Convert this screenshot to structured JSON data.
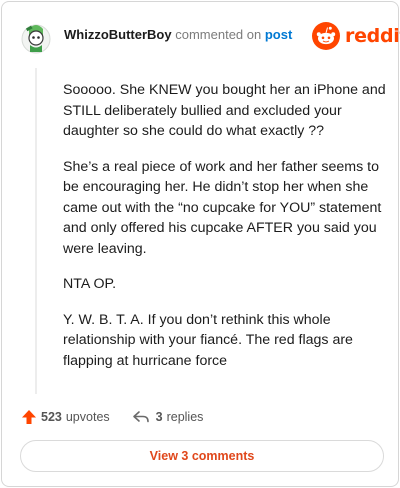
{
  "header": {
    "username": "WhizzoButterBoy",
    "commented_on": "commented on",
    "post_link": "post",
    "brand": "reddit",
    "brand_color": "#ff4500",
    "avatar_icon": "snoo-avatar-icon"
  },
  "comment": {
    "paragraphs": [
      "Sooooo. She KNEW you bought her an iPhone and STILL deliberately bullied and excluded your daughter so she could do what exactly ??",
      "She’s a real piece of work and her father seems to be encouraging her. He didn’t stop her when she came out with the “no cupcake for YOU” statement and only offered his cupcake AFTER you said you were leaving.",
      "NTA OP.",
      "Y. W. B. T. A. If you don’t rethink this whole relationship with your fiancé. The red flags are flapping at hurricane force"
    ]
  },
  "actions": {
    "upvotes_count": "523",
    "upvotes_label": "upvotes",
    "replies_count": "3",
    "replies_label": "replies",
    "upvote_icon": "upvote-arrow-icon",
    "reply_icon": "reply-arrow-icon",
    "upvote_color": "#ff4500"
  },
  "view_comments": {
    "label": "View 3 comments",
    "color": "#e0471b"
  }
}
